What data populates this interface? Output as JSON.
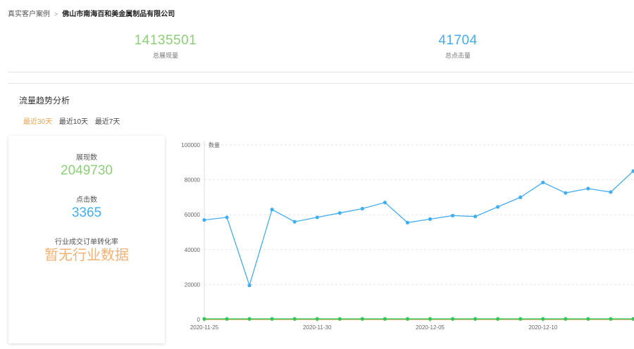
{
  "breadcrumb": {
    "link": "真实客户案例",
    "current": "佛山市南海百和美金属制品有限公司"
  },
  "stats": {
    "impressions": {
      "value": "14135501",
      "label": "总展现量"
    },
    "clicks": {
      "value": "41704",
      "label": "总点击量"
    }
  },
  "trend": {
    "title": "流量趋势分析",
    "tabs": [
      "最近30天",
      "最近10天",
      "最近7天"
    ],
    "active_tab": 0
  },
  "summary": {
    "impressions_label": "展现数",
    "impressions_value": "2049730",
    "clicks_label": "点击数",
    "clicks_value": "3365",
    "conversion_label": "行业成交订单转化率",
    "conversion_value": "暂无行业数据"
  },
  "colors": {
    "green": "#8dcf78",
    "blue": "#42aef0",
    "orange": "#f0a24b",
    "green_line": "#3ac35a",
    "orange_line": "#f0a24b"
  },
  "chart_data": {
    "type": "line",
    "ylabel": "数量",
    "ylim": [
      0,
      100000
    ],
    "yticks": [
      0,
      20000,
      40000,
      60000,
      80000,
      100000
    ],
    "x_tick_labels": [
      "2020-11-25",
      "2020-11-30",
      "2020-12-05",
      "2020-12-10"
    ],
    "x_tick_index": [
      0,
      5,
      10,
      15
    ],
    "grid": true,
    "series": [
      {
        "color": "#42aef0",
        "values": [
          57000,
          58500,
          19500,
          63000,
          56000,
          58500,
          61000,
          63500,
          67000,
          55500,
          57500,
          59500,
          59000,
          64500,
          70000,
          78500,
          72500,
          75000,
          73000,
          85000
        ]
      },
      {
        "color": "#3ac35a",
        "values": [
          300,
          300,
          300,
          300,
          300,
          300,
          300,
          300,
          300,
          300,
          300,
          300,
          300,
          300,
          300,
          300,
          300,
          300,
          300,
          300
        ]
      }
    ]
  }
}
